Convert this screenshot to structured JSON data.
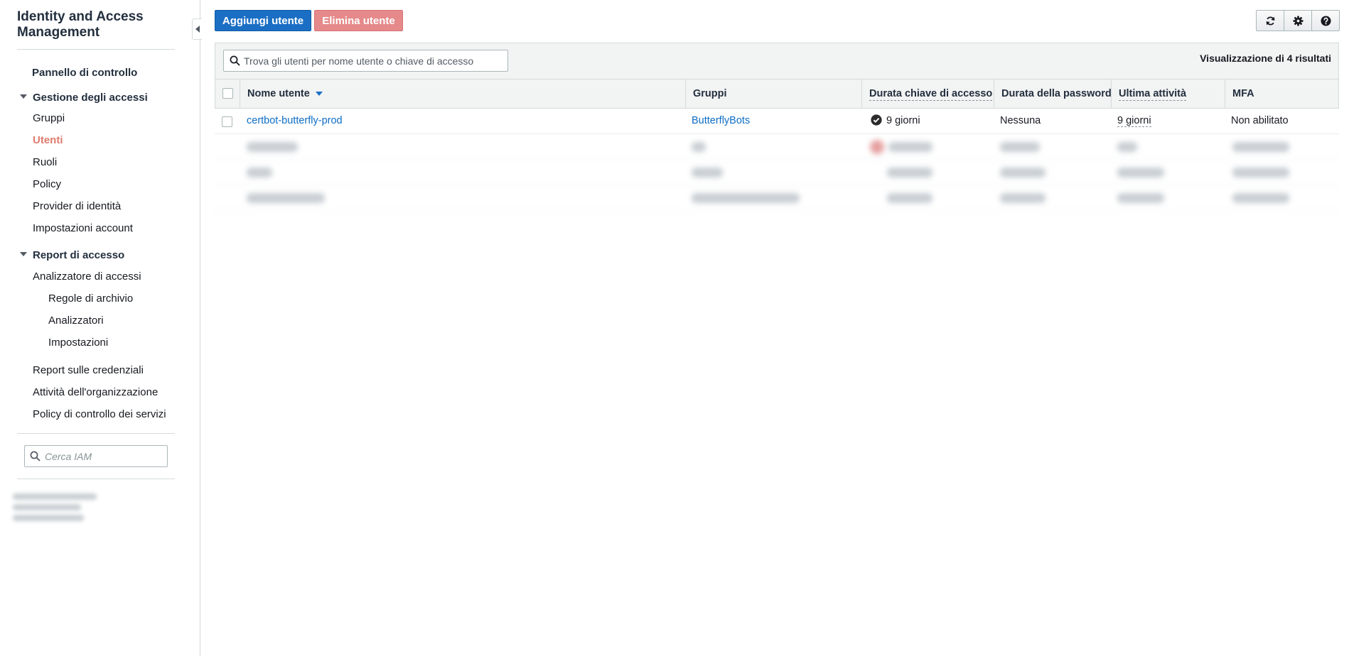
{
  "sidebar": {
    "title": "Identity and Access Management",
    "dashboard": "Pannello di controllo",
    "access_management": {
      "label": "Gestione degli accessi",
      "items": [
        "Gruppi",
        "Utenti",
        "Ruoli",
        "Policy",
        "Provider di identità",
        "Impostazioni account"
      ]
    },
    "access_reports": {
      "label": "Report di accesso",
      "analyzer": "Analizzatore di accessi",
      "analyzer_items": [
        "Regole di archivio",
        "Analizzatori",
        "Impostazioni"
      ],
      "items": [
        "Report sulle credenziali",
        "Attività dell'organizzazione",
        "Policy di controllo dei servizi"
      ]
    },
    "search_placeholder": "Cerca IAM",
    "active_item": "Utenti"
  },
  "toolbar": {
    "add_user": "Aggiungi utente",
    "delete_user": "Elimina utente",
    "icons": [
      "refresh-icon",
      "gear-icon",
      "help-icon"
    ]
  },
  "table": {
    "search_placeholder": "Trova gli utenti per nome utente o chiave di accesso",
    "results_label": "Visualizzazione di 4 risultati",
    "columns": [
      "Nome utente",
      "Gruppi",
      "Durata chiave di accesso",
      "Durata della password",
      "Ultima attività",
      "MFA"
    ],
    "rows": [
      {
        "user": "certbot-butterfly-prod",
        "groups": "ButterflyBots",
        "access_key_age": "9 giorni",
        "password_age": "Nessuna",
        "last_activity": "9 giorni",
        "mfa": "Non abilitato"
      }
    ]
  },
  "colors": {
    "primary": "#1a6fc4",
    "danger_disabled": "#e5898a",
    "link": "#0d6dc4",
    "active_nav": "#e07b6c"
  }
}
